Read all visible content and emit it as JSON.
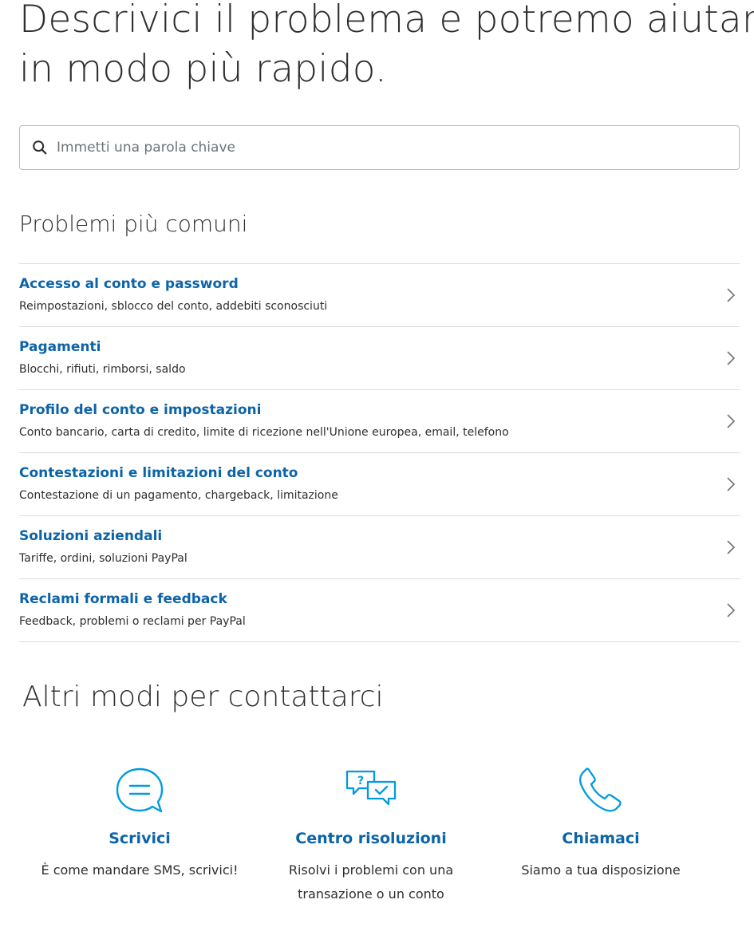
{
  "hero": {
    "line1": "Descrivici il problema e potremo aiutarti",
    "line2": "in modo più rapido."
  },
  "search": {
    "placeholder": "Immetti una parola chiave",
    "icon": "search-icon"
  },
  "common": {
    "title": "Problemi più comuni",
    "items": [
      {
        "title": "Accesso al conto e password",
        "desc": "Reimpostazioni, sblocco del conto, addebiti sconosciuti"
      },
      {
        "title": "Pagamenti",
        "desc": "Blocchi, rifiuti, rimborsi, saldo"
      },
      {
        "title": "Profilo del conto e impostazioni",
        "desc": "Conto bancario, carta di credito, limite di ricezione nell'Unione europea, email, telefono"
      },
      {
        "title": "Contestazioni e limitazioni del conto",
        "desc": "Contestazione di un pagamento, chargeback, limitazione"
      },
      {
        "title": "Soluzioni aziendali",
        "desc": "Tariffe, ordini, soluzioni PayPal"
      },
      {
        "title": "Reclami formali e feedback",
        "desc": "Feedback, problemi o reclami per PayPal"
      }
    ]
  },
  "contact": {
    "title": "Altri modi per contattarci",
    "cards": [
      {
        "title": "Scrivici",
        "desc": "È come mandare SMS, scrivici!",
        "icon": "chat-bubble-icon"
      },
      {
        "title": "Centro risoluzioni",
        "desc": "Risolvi i problemi con una transazione o un conto",
        "icon": "resolution-center-icon"
      },
      {
        "title": "Chiamaci",
        "desc": "Siamo a tua disposizione",
        "icon": "phone-icon"
      }
    ]
  },
  "colors": {
    "link": "#0c64a8",
    "icon": "#009cde",
    "text": "#2c2e2f",
    "divider": "#d9dcde"
  }
}
